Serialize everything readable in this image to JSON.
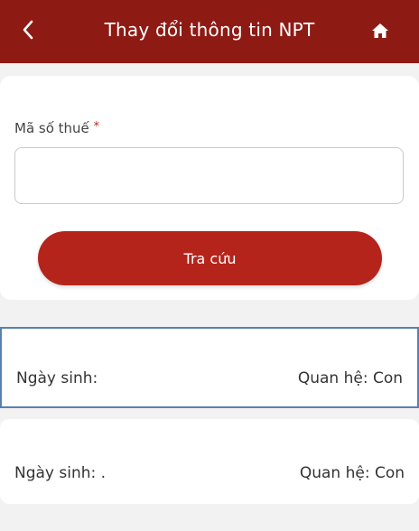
{
  "header": {
    "title": "Thay đổi thông tin NPT",
    "background": "#8e1a14"
  },
  "icons": {
    "back": "chevron-left-icon",
    "home": "home-icon"
  },
  "search": {
    "label": "Mã số thuế",
    "required_mark": "*",
    "input_value": "",
    "button_label": "Tra cứu",
    "button_color": "#b5241b"
  },
  "dependents": [
    {
      "dob_label": "Ngày sinh:",
      "relation_label": "Quan hệ: Con",
      "selected": true
    },
    {
      "dob_label": "Ngày sinh: .",
      "relation_label": "Quan hệ: Con",
      "selected": false
    }
  ],
  "colors": {
    "selected_border": "#5a7fb3",
    "page_background": "#f2f2f2"
  }
}
